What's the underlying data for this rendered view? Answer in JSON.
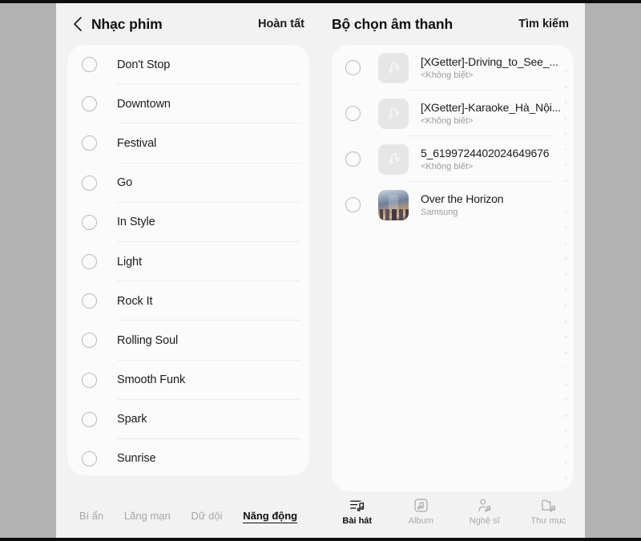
{
  "left_pane": {
    "back_icon": "chevron-left-icon",
    "title": "Nhạc phim",
    "action_label": "Hoàn tất",
    "sounds": [
      {
        "label": "Don't Stop"
      },
      {
        "label": "Downtown"
      },
      {
        "label": "Festival"
      },
      {
        "label": "Go"
      },
      {
        "label": "In Style"
      },
      {
        "label": "Light"
      },
      {
        "label": "Rock It"
      },
      {
        "label": "Rolling Soul"
      },
      {
        "label": "Smooth Funk"
      },
      {
        "label": "Spark"
      },
      {
        "label": "Sunrise"
      }
    ],
    "tabs": [
      {
        "label": "Bí ẩn",
        "active": false
      },
      {
        "label": "Lãng mạn",
        "active": false
      },
      {
        "label": "Dữ dội",
        "active": false
      },
      {
        "label": "Năng động",
        "active": true
      }
    ]
  },
  "right_pane": {
    "title": "Bộ chọn âm thanh",
    "action_label": "Tìm kiếm",
    "tracks": [
      {
        "title": "[XGetter]-Driving_to_See_...",
        "artist": "<Không biết>",
        "thumb": "music-note-icon"
      },
      {
        "title": "[XGetter]-Karaoke_Hà_Nội...",
        "artist": "<Không biết>",
        "thumb": "music-note-icon"
      },
      {
        "title": "5_6199724402024649676",
        "artist": "<Không biết>",
        "thumb": "music-note-icon"
      },
      {
        "title": "Over the Horizon",
        "artist": "Samsung",
        "thumb": "album-art"
      }
    ],
    "index_letters": [
      "A",
      "B",
      "C",
      "D",
      "E",
      "F",
      "G",
      "H",
      "I",
      "J",
      "K",
      "L",
      "M",
      "N",
      "O",
      "P",
      "Q",
      "R",
      "S",
      "T",
      "U",
      "V",
      "W",
      "X",
      "Y",
      "Z",
      "#"
    ],
    "tabs": [
      {
        "label": "Bài hát",
        "icon": "songs-icon",
        "active": true
      },
      {
        "label": "Album",
        "icon": "album-icon",
        "active": false
      },
      {
        "label": "Nghệ sĩ",
        "icon": "artist-icon",
        "active": false
      },
      {
        "label": "Thư mục",
        "icon": "folder-icon",
        "active": false
      }
    ]
  },
  "theme": {
    "page_background": "#f2f2f2",
    "card_background": "#fbfbfb",
    "frame_color": "#b2b2b2",
    "text_primary": "#1b1b1b",
    "text_muted": "#9b9b9b"
  }
}
